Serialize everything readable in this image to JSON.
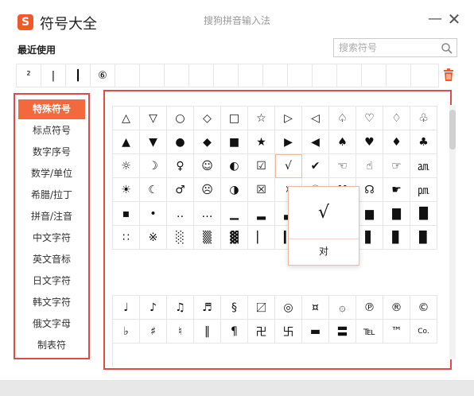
{
  "app": {
    "logo_letter": "S",
    "title": "符号大全",
    "ime_name": "搜狗拼音输入法",
    "minimize_glyph": "—",
    "close_glyph": "✕"
  },
  "recent": {
    "label": "最近使用",
    "items": [
      "²",
      "|",
      "┃",
      "⑥"
    ]
  },
  "search": {
    "placeholder": "搜索符号",
    "value": ""
  },
  "categories": [
    {
      "label": "特殊符号",
      "active": true
    },
    {
      "label": "标点符号"
    },
    {
      "label": "数字序号"
    },
    {
      "label": "数学/单位"
    },
    {
      "label": "希腊/拉丁"
    },
    {
      "label": "拼音/注音"
    },
    {
      "label": "中文字符"
    },
    {
      "label": "英文音标"
    },
    {
      "label": "日文字符"
    },
    {
      "label": "韩文字符"
    },
    {
      "label": "俄文字母"
    },
    {
      "label": "制表符"
    }
  ],
  "grid1": [
    "△",
    "▽",
    "○",
    "◇",
    "□",
    "☆",
    "▷",
    "◁",
    "♤",
    "♡",
    "♢",
    "♧",
    "▲",
    "▼",
    "●",
    "◆",
    "■",
    "★",
    "▶",
    "◀",
    "♠",
    "♥",
    "♦",
    "♣",
    "☼",
    "☽",
    "♀",
    "☺",
    "◐",
    "☑",
    "√",
    "✔",
    "☜",
    "☝",
    "☞",
    "㏂",
    "☀",
    "☾",
    "♂",
    "☹",
    "◑",
    "☒",
    "☓",
    "☯",
    "☋",
    "☊",
    "☛",
    "㏘",
    "▪",
    "•",
    "‥",
    "…",
    "▁",
    "▂",
    "▃",
    "▄",
    "▅",
    "▆",
    "▇",
    "█",
    "∷",
    "※",
    "░",
    "▒",
    "▓",
    "▏",
    "▎",
    "▍",
    "▌",
    "▋",
    "▊",
    "▉"
  ],
  "grid2": [
    "♩",
    "♪",
    "♫",
    "♬",
    "§",
    "〼",
    "◎",
    "¤",
    "۞",
    "℗",
    "®",
    "©",
    "♭",
    "♯",
    "♮",
    "‖",
    "¶",
    "卍",
    "卐",
    "▬",
    "〓",
    "℡",
    "™",
    "Co."
  ],
  "preview": {
    "symbol": "√",
    "name": "对"
  }
}
